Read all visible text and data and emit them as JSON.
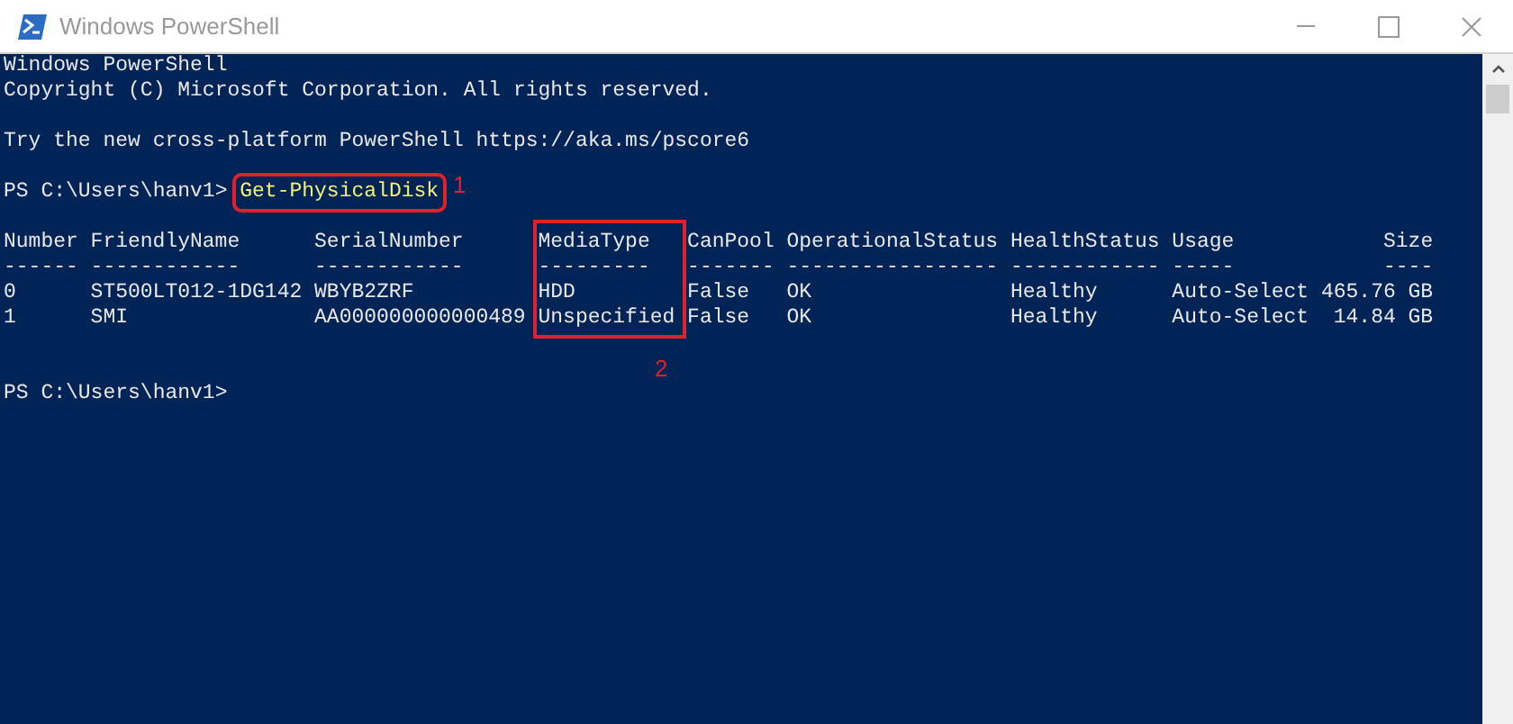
{
  "window": {
    "title": "Windows PowerShell"
  },
  "console": {
    "banner": [
      [
        "Windows PowerShell",
        "Copyright (C) Microsoft Corporation. All rights reserved."
      ],
      [
        "Try the new cross-platform PowerShell https://aka.ms/pscore6"
      ]
    ],
    "prompt": "PS C:\\Users\\hanv1>",
    "command": {
      "text": "Get-PhysicalDisk",
      "callout": "1"
    },
    "table": {
      "columns": [
        {
          "label": "Number",
          "rule": "------"
        },
        {
          "label": "FriendlyName",
          "rule": "------------"
        },
        {
          "label": "SerialNumber",
          "rule": "------------"
        },
        {
          "label": "MediaType",
          "rule": "---------",
          "callout": "2"
        },
        {
          "label": "CanPool",
          "rule": "-------"
        },
        {
          "label": "OperationalStatus",
          "rule": "-----------------"
        },
        {
          "label": "HealthStatus",
          "rule": "------------"
        },
        {
          "label": "Usage",
          "rule": "-----"
        },
        {
          "label": "Size",
          "rule": "----"
        }
      ],
      "rows": [
        [
          "0",
          "ST500LT012-1DG142",
          "WBYB2ZRF",
          "HDD",
          "False",
          "OK",
          "Healthy",
          "Auto-Select",
          "465.76 GB"
        ],
        [
          "1",
          "SMI",
          "AA000000000000489",
          "Unspecified",
          "False",
          "OK",
          "Healthy",
          "Auto-Select",
          "14.84 GB"
        ]
      ]
    },
    "final_prompt": "PS C:\\Users\\hanv1>"
  }
}
